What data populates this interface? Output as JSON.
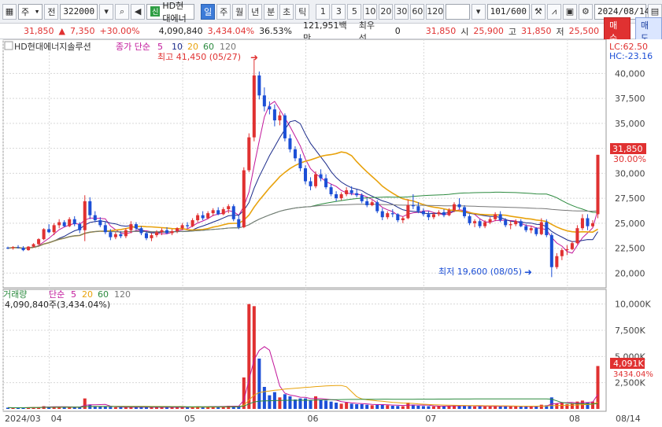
{
  "toolbar": {
    "market_combo": "주",
    "prev_button": "전",
    "code": "322000",
    "stock_badge": "신",
    "stock_name": "HD현대에너",
    "periods": [
      "일",
      "주",
      "월",
      "년",
      "분",
      "초",
      "틱"
    ],
    "active_period": "일",
    "intervals": [
      "1",
      "3",
      "5",
      "10",
      "20",
      "30",
      "60",
      "120"
    ],
    "bar_count": "101",
    "bar_total": "/600",
    "date": "2024/08/14"
  },
  "info": {
    "price": "31,850",
    "change": "7,350",
    "change_pct": "+30.00%",
    "volume": "4,090,840",
    "volume_ratio": "3,434.04%",
    "turnover": "36.53%",
    "amount": "121,951백만",
    "priority_label": "최우선",
    "priority_value": "0",
    "current": "31,850",
    "open_label": "시",
    "open": "25,900",
    "high_label": "고",
    "high": "31,850",
    "low_label": "저",
    "low": "25,500",
    "buy_button": "매수",
    "sell_button": "매도"
  },
  "legend": {
    "stock": "HD현대에너지솔루션",
    "ma_title": "종가 단순",
    "ma_periods": [
      "5",
      "10",
      "20",
      "60",
      "120"
    ],
    "lc": "LC:62.50",
    "hc": "HC:-23.16",
    "vol_title": "거래량",
    "vol_ma_title": "단순",
    "vol_periods": [
      "5",
      "20",
      "60",
      "120"
    ],
    "vol_value": "4,090,840주(3,434.04%)"
  },
  "annotations": {
    "high": "최고 41,450 (05/27)",
    "low": "최저 19,600 (08/05)",
    "price_tag": "31,850",
    "pct_tag": "30.00%",
    "vol_tag": "4,091K",
    "vol_pct": "3434.04%"
  },
  "colors": {
    "up": "#e03131",
    "down": "#1c4fd6",
    "ma5": "#c2189b",
    "ma10": "#1a2a8a",
    "ma20": "#e8a20c",
    "ma60": "#2b8a3e",
    "ma120": "#777777"
  },
  "chart_data": [
    {
      "type": "candlestick",
      "title": "HD현대에너지솔루션",
      "ylim": [
        19000,
        42000
      ],
      "y_ticks": [
        20000,
        22500,
        25000,
        27500,
        30000,
        32500,
        35000,
        37500,
        40000
      ],
      "y_tick_labels": [
        "20,000",
        "22,500",
        "25,000",
        "27,500",
        "30,000",
        "32,500",
        "35,000",
        "37,500",
        "40,000"
      ],
      "x_tick_labels": [
        "2024/03",
        "04",
        "05",
        "06",
        "07",
        "08",
        "08/14"
      ],
      "x_tick_index": [
        0,
        9,
        35,
        59,
        82,
        110,
        128
      ],
      "ohlc": [
        [
          22550,
          22650,
          22400,
          22500
        ],
        [
          22500,
          22700,
          22350,
          22600
        ],
        [
          22600,
          22800,
          22450,
          22550
        ],
        [
          22550,
          22700,
          22200,
          22300
        ],
        [
          22300,
          22700,
          22250,
          22650
        ],
        [
          22650,
          23000,
          22550,
          22900
        ],
        [
          22900,
          23500,
          22800,
          23400
        ],
        [
          23400,
          24500,
          23300,
          24400
        ],
        [
          24400,
          24900,
          24000,
          24100
        ],
        [
          24100,
          25000,
          23800,
          24800
        ],
        [
          24800,
          25400,
          24500,
          25100
        ],
        [
          25100,
          25300,
          24600,
          24700
        ],
        [
          24700,
          25600,
          24600,
          25400
        ],
        [
          25400,
          25700,
          24700,
          24900
        ],
        [
          24900,
          25100,
          24000,
          24300
        ],
        [
          24300,
          27800,
          23200,
          27200
        ],
        [
          27200,
          27600,
          25400,
          25800
        ],
        [
          25800,
          26200,
          25100,
          25300
        ],
        [
          25300,
          25600,
          24600,
          24800
        ],
        [
          24800,
          25200,
          23900,
          24100
        ],
        [
          24100,
          24400,
          23300,
          23600
        ],
        [
          23600,
          24100,
          23400,
          23900
        ],
        [
          23900,
          24200,
          23500,
          23700
        ],
        [
          23700,
          24500,
          23500,
          24300
        ],
        [
          24300,
          25200,
          24000,
          24900
        ],
        [
          24900,
          25100,
          24300,
          24500
        ],
        [
          24500,
          24700,
          23800,
          24000
        ],
        [
          24000,
          24200,
          23300,
          23500
        ],
        [
          23500,
          24000,
          23200,
          23800
        ],
        [
          23800,
          24300,
          23600,
          24100
        ],
        [
          24100,
          24500,
          23800,
          24300
        ],
        [
          24300,
          24600,
          23900,
          24000
        ],
        [
          24000,
          24400,
          23800,
          24200
        ],
        [
          24200,
          24600,
          24000,
          24500
        ],
        [
          24500,
          25000,
          24300,
          24800
        ],
        [
          24800,
          25100,
          24500,
          24700
        ],
        [
          24700,
          25500,
          24600,
          25300
        ],
        [
          25300,
          26000,
          25100,
          25800
        ],
        [
          25800,
          26200,
          25300,
          25500
        ],
        [
          25500,
          26200,
          25400,
          26000
        ],
        [
          26000,
          26500,
          25700,
          26300
        ],
        [
          26300,
          26600,
          25800,
          25900
        ],
        [
          25900,
          26600,
          25800,
          26400
        ],
        [
          26400,
          26900,
          26000,
          26700
        ],
        [
          26700,
          26900,
          25200,
          25400
        ],
        [
          25400,
          25800,
          24400,
          24600
        ],
        [
          24600,
          30600,
          24500,
          30300
        ],
        [
          30300,
          34000,
          30100,
          33600
        ],
        [
          33600,
          41450,
          33200,
          39800
        ],
        [
          39800,
          40200,
          37400,
          37800
        ],
        [
          37800,
          38600,
          36200,
          36700
        ],
        [
          36700,
          37200,
          35900,
          36400
        ],
        [
          36400,
          36900,
          34700,
          35300
        ],
        [
          35300,
          36200,
          34800,
          35800
        ],
        [
          35800,
          36000,
          33200,
          33500
        ],
        [
          33500,
          33900,
          32100,
          32400
        ],
        [
          32400,
          32700,
          31200,
          31500
        ],
        [
          31500,
          31900,
          30200,
          30500
        ],
        [
          30500,
          30800,
          28900,
          29200
        ],
        [
          29200,
          29600,
          28300,
          28700
        ],
        [
          28700,
          30200,
          28500,
          29900
        ],
        [
          29900,
          30400,
          29200,
          29500
        ],
        [
          29500,
          29900,
          28400,
          28600
        ],
        [
          28600,
          28900,
          27700,
          27900
        ],
        [
          27900,
          28200,
          27200,
          27500
        ],
        [
          27500,
          28100,
          27300,
          27900
        ],
        [
          27900,
          28600,
          27700,
          28300
        ],
        [
          28300,
          28700,
          27800,
          28000
        ],
        [
          28000,
          28400,
          27600,
          27800
        ],
        [
          27800,
          28000,
          27000,
          27200
        ],
        [
          27200,
          27500,
          26600,
          26800
        ],
        [
          26800,
          27300,
          26700,
          27100
        ],
        [
          27100,
          27300,
          26000,
          26200
        ],
        [
          26200,
          26500,
          25300,
          25600
        ],
        [
          25600,
          26200,
          25400,
          26000
        ],
        [
          26000,
          26400,
          25600,
          25900
        ],
        [
          25900,
          26000,
          25100,
          25300
        ],
        [
          25300,
          25700,
          25000,
          25500
        ],
        [
          25500,
          27400,
          25400,
          26800
        ],
        [
          26800,
          27900,
          26400,
          26700
        ],
        [
          26700,
          27100,
          26000,
          26200
        ],
        [
          26200,
          26500,
          25700,
          25900
        ],
        [
          25900,
          26200,
          25300,
          25600
        ],
        [
          25600,
          26100,
          25400,
          25900
        ],
        [
          25900,
          26300,
          25700,
          26100
        ],
        [
          26100,
          26400,
          25600,
          25800
        ],
        [
          25800,
          26500,
          25700,
          26300
        ],
        [
          26300,
          27100,
          26100,
          26900
        ],
        [
          26900,
          27500,
          26400,
          26600
        ],
        [
          26600,
          26800,
          25500,
          25700
        ],
        [
          25700,
          25900,
          24800,
          25000
        ],
        [
          25000,
          25400,
          24600,
          25200
        ],
        [
          25200,
          25400,
          24500,
          24700
        ],
        [
          24700,
          25300,
          24500,
          25100
        ],
        [
          25100,
          25600,
          24900,
          25400
        ],
        [
          25400,
          26100,
          25200,
          25900
        ],
        [
          25900,
          26200,
          25100,
          25300
        ],
        [
          25300,
          25500,
          24600,
          24800
        ],
        [
          24800,
          25200,
          24400,
          24900
        ],
        [
          24900,
          25400,
          24700,
          25200
        ],
        [
          25200,
          25400,
          24600,
          24700
        ],
        [
          24700,
          24900,
          24100,
          24300
        ],
        [
          24300,
          24700,
          24000,
          24500
        ],
        [
          24500,
          24600,
          23700,
          23900
        ],
        [
          23900,
          25500,
          23800,
          25100
        ],
        [
          25100,
          25400,
          23600,
          23800
        ],
        [
          23800,
          24000,
          19600,
          20600
        ],
        [
          20600,
          22000,
          20400,
          21700
        ],
        [
          21700,
          22500,
          21300,
          22300
        ],
        [
          22300,
          22800,
          21800,
          22400
        ],
        [
          22400,
          23200,
          22300,
          23000
        ],
        [
          23000,
          24800,
          22900,
          24500
        ],
        [
          24500,
          25900,
          24300,
          25500
        ],
        [
          25500,
          25900,
          24300,
          24700
        ],
        [
          24700,
          25300,
          24600,
          25000
        ],
        [
          25900,
          31850,
          25500,
          31850
        ]
      ],
      "ma5": "computed",
      "volume_ylim": [
        0,
        10500
      ],
      "volume_ticks": [
        2500,
        5000,
        7500,
        10000
      ],
      "volume_tick_labels": [
        "2,500K",
        "5,000K",
        "7,500K",
        "10,000K"
      ],
      "volume_k": [
        120,
        110,
        100,
        130,
        140,
        160,
        180,
        260,
        210,
        190,
        200,
        170,
        220,
        160,
        150,
        1000,
        420,
        260,
        240,
        210,
        180,
        160,
        150,
        170,
        190,
        160,
        150,
        160,
        170,
        150,
        160,
        140,
        150,
        170,
        190,
        160,
        200,
        240,
        200,
        230,
        260,
        210,
        250,
        300,
        280,
        300,
        3000,
        10000,
        9800,
        4800,
        2100,
        1300,
        1600,
        1100,
        1400,
        1200,
        900,
        1000,
        1000,
        800,
        1200,
        900,
        800,
        700,
        600,
        500,
        600,
        500,
        450,
        450,
        400,
        350,
        400,
        450,
        350,
        300,
        280,
        260,
        600,
        400,
        300,
        270,
        260,
        240,
        280,
        260,
        300,
        350,
        280,
        300,
        280,
        240,
        260,
        220,
        260,
        300,
        240,
        260,
        230,
        250,
        220,
        210,
        230,
        250,
        400,
        350,
        1100,
        500,
        600,
        450,
        500,
        700,
        800,
        600,
        700,
        4091
      ]
    }
  ]
}
